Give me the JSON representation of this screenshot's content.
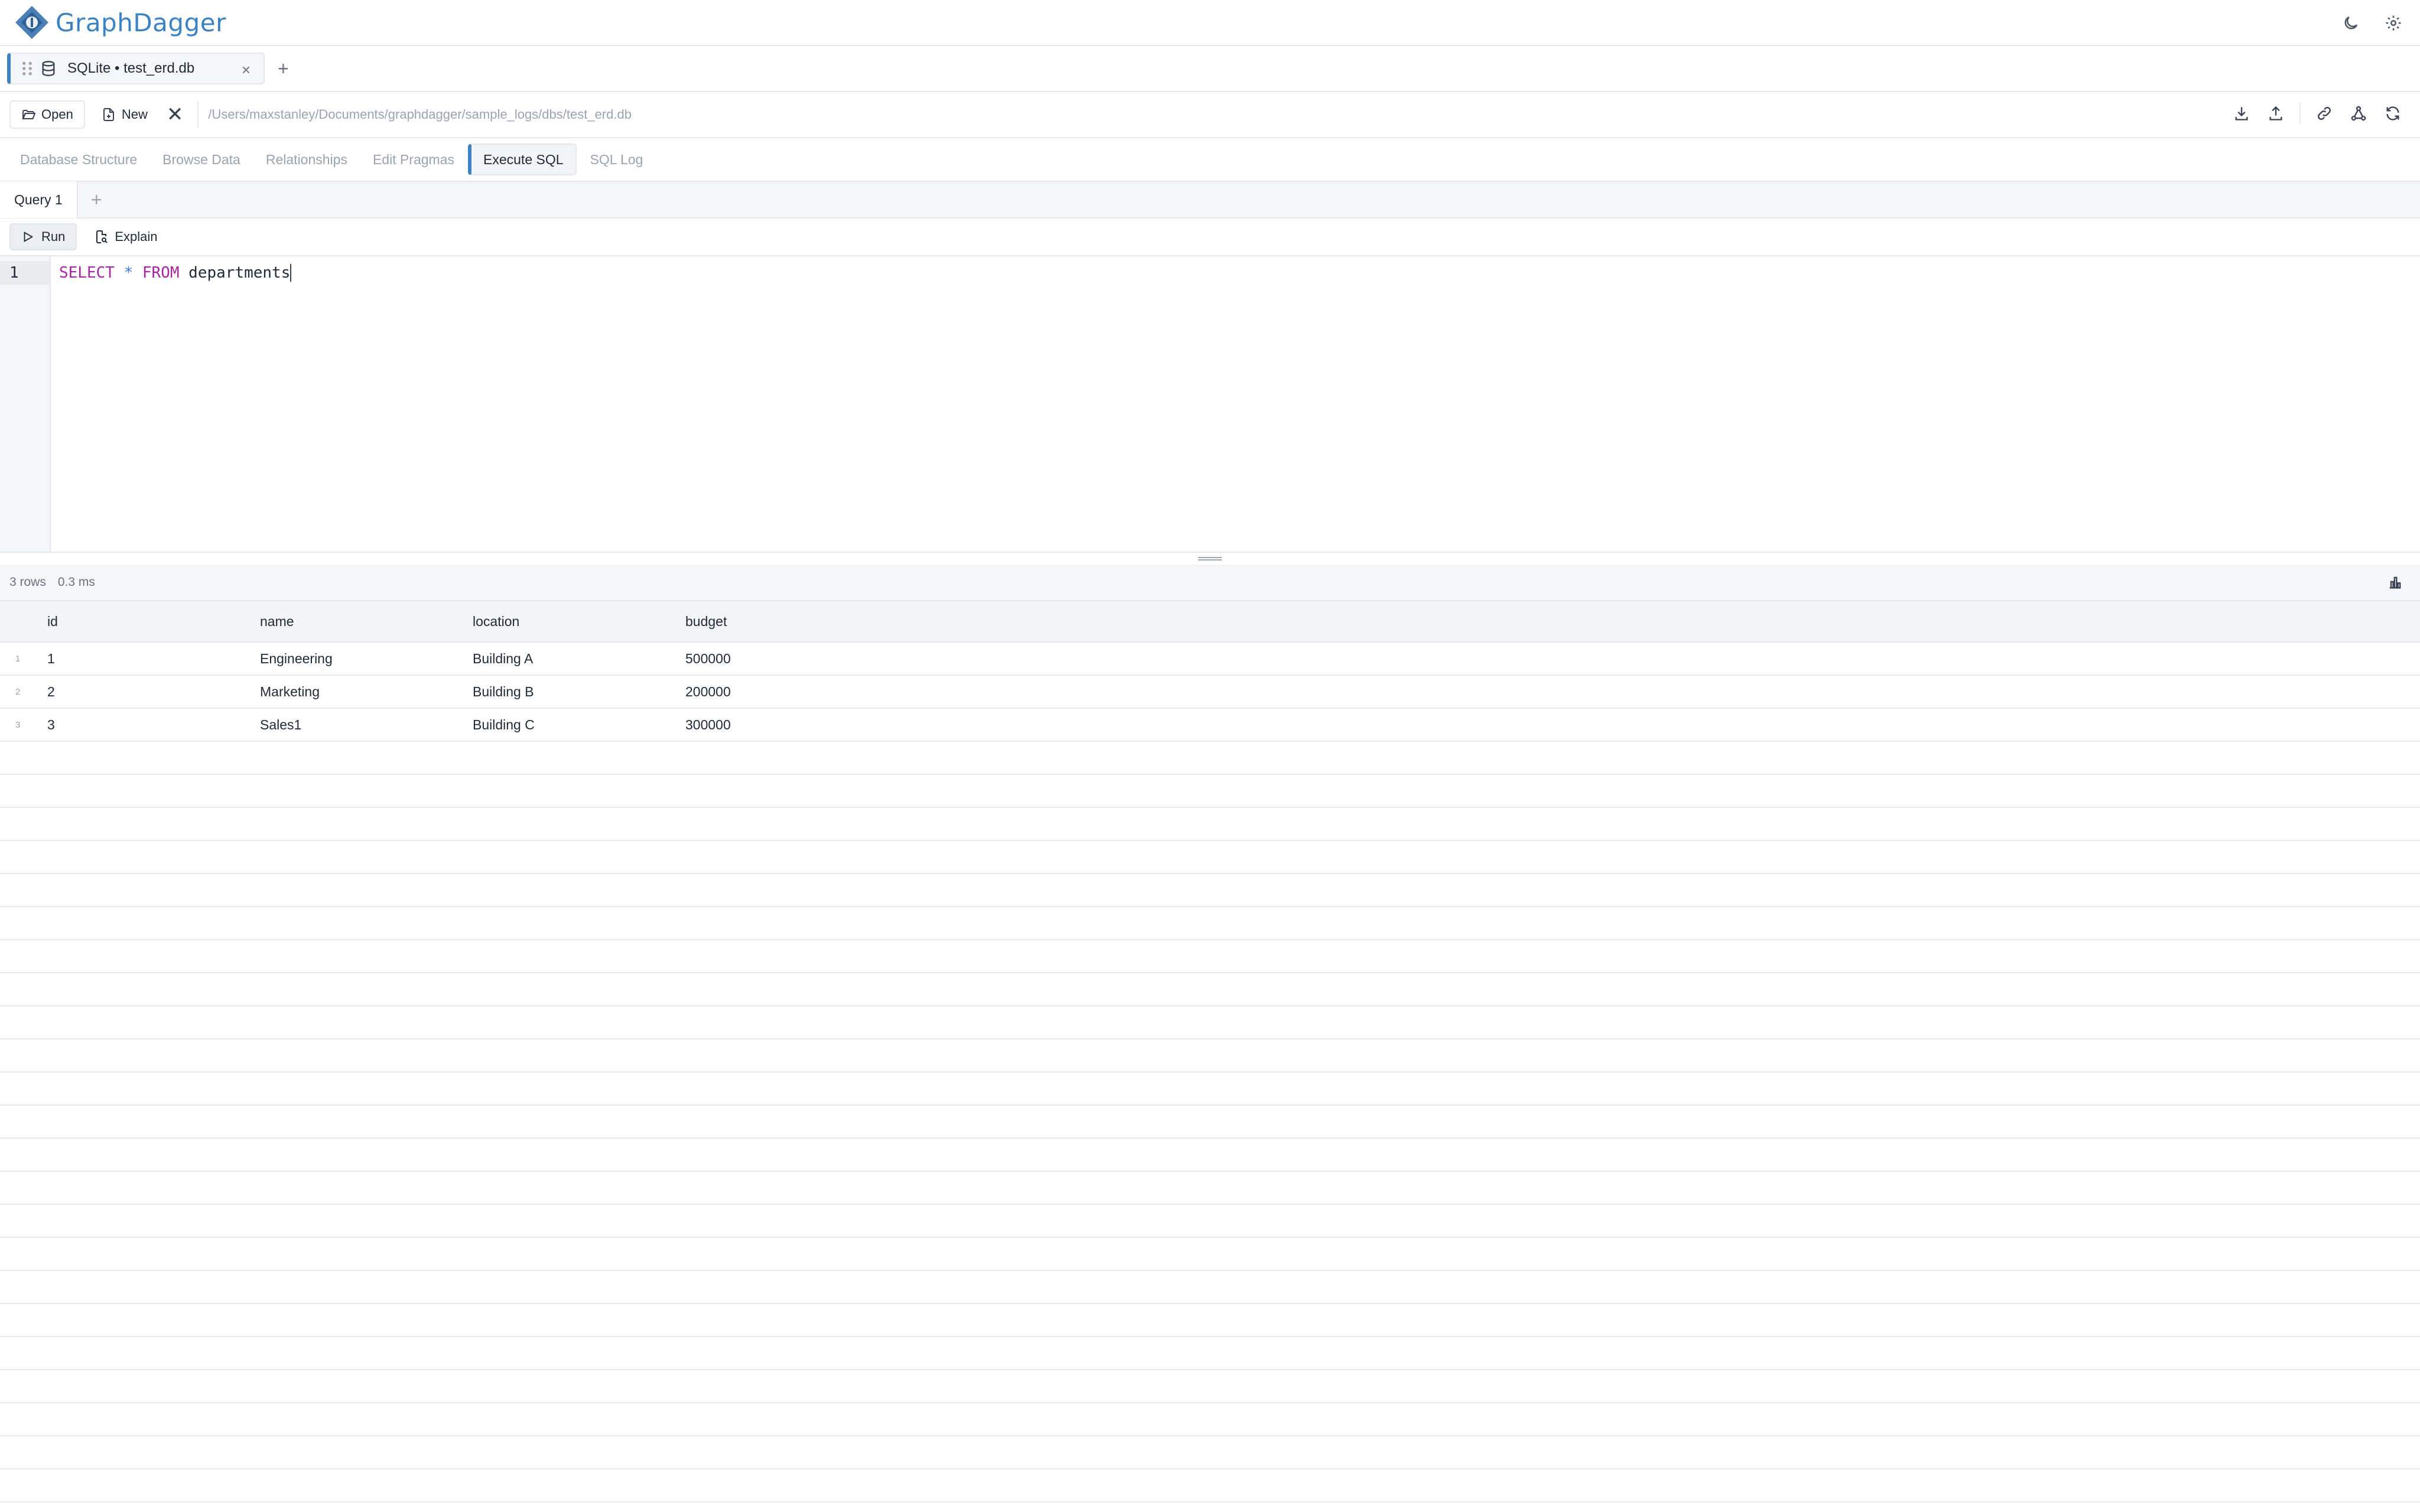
{
  "app": {
    "name": "GraphDagger"
  },
  "connection_tab": {
    "label": "SQLite • test_erd.db",
    "close": "×",
    "add": "+"
  },
  "toolbar": {
    "open_label": "Open",
    "new_label": "New",
    "close_label": "✕",
    "path": "/Users/maxstanley/Documents/graphdagger/sample_logs/dbs/test_erd.db"
  },
  "view_tabs": [
    {
      "label": "Database Structure",
      "active": false
    },
    {
      "label": "Browse Data",
      "active": false
    },
    {
      "label": "Relationships",
      "active": false
    },
    {
      "label": "Edit Pragmas",
      "active": false
    },
    {
      "label": "Execute SQL",
      "active": true
    },
    {
      "label": "SQL Log",
      "active": false
    }
  ],
  "query_tabs": {
    "tabs": [
      "Query 1"
    ],
    "add": "+"
  },
  "actions": {
    "run_label": "Run",
    "explain_label": "Explain"
  },
  "editor": {
    "line_number": "1",
    "tokens": {
      "select": "SELECT",
      "star": "*",
      "from": "FROM",
      "table": "departments"
    }
  },
  "results": {
    "row_count": "3 rows",
    "elapsed": "0.3 ms",
    "columns": [
      "id",
      "name",
      "location",
      "budget"
    ],
    "rows": [
      {
        "num": "1",
        "cells": [
          "1",
          "Engineering",
          "Building A",
          "500000"
        ]
      },
      {
        "num": "2",
        "cells": [
          "2",
          "Marketing",
          "Building B",
          "200000"
        ]
      },
      {
        "num": "3",
        "cells": [
          "3",
          "Sales1",
          "Building C",
          "300000"
        ]
      }
    ]
  },
  "colors": {
    "accent": "#3b82c4",
    "keyword": "#a626a4",
    "operator": "#4078f2"
  }
}
